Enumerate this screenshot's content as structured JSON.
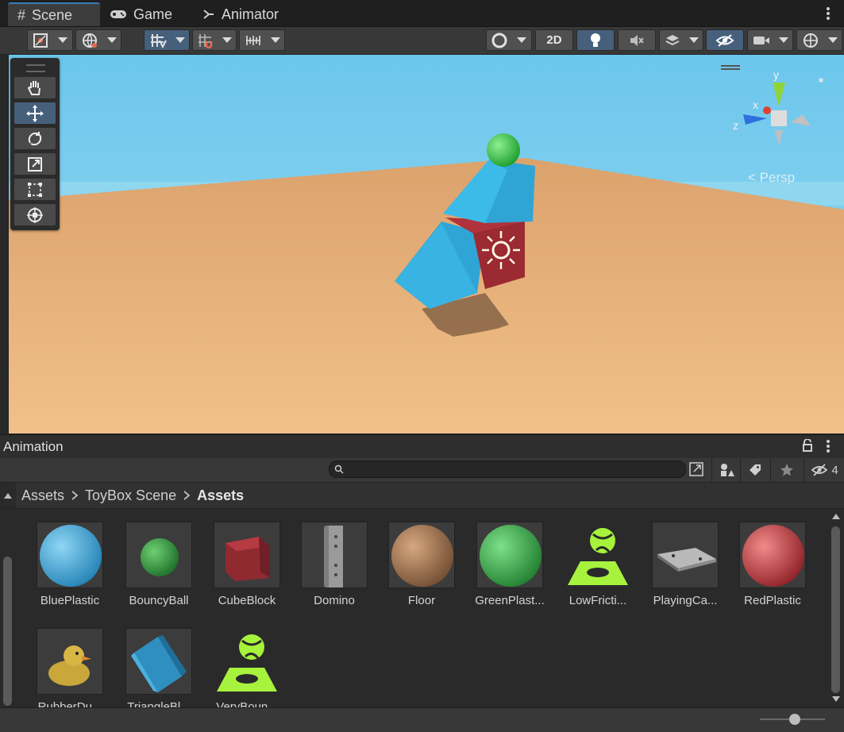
{
  "tabs": [
    {
      "label": "Scene",
      "icon": "grid-icon",
      "active": true
    },
    {
      "label": "Game",
      "icon": "gamepad-icon",
      "active": false
    },
    {
      "label": "Animator",
      "icon": "animator-icon",
      "active": false
    }
  ],
  "toolbar": {
    "mode_2d_label": "2D"
  },
  "scene": {
    "camera_label": "< Persp",
    "gizmo": {
      "x": "x",
      "y": "y",
      "z": "z"
    }
  },
  "animation_panel": {
    "title": "Animation",
    "search_placeholder": "",
    "hidden_count": "4"
  },
  "breadcrumb": [
    "Assets",
    "ToyBox Scene",
    "Assets"
  ],
  "assets": [
    {
      "label": "BluePlastic",
      "kind": "sphere",
      "color": "#3aa6d8"
    },
    {
      "label": "BouncyBall",
      "kind": "small-sphere",
      "color": "#2f8f3a"
    },
    {
      "label": "CubeBlock",
      "kind": "cube",
      "color": "#a8323a"
    },
    {
      "label": "Domino",
      "kind": "domino",
      "color": "#8a8a8a"
    },
    {
      "label": "Floor",
      "kind": "sphere",
      "color": "#a87a55"
    },
    {
      "label": "GreenPlast...",
      "kind": "sphere",
      "color": "#34a845"
    },
    {
      "label": "LowFricti...",
      "kind": "physics-material",
      "color": "#9ef23a"
    },
    {
      "label": "PlayingCa...",
      "kind": "card",
      "color": "#9a9a9a"
    },
    {
      "label": "RedPlastic",
      "kind": "sphere",
      "color": "#c9333a"
    },
    {
      "label": "RubberDu...",
      "kind": "duck",
      "color": "#c9a73a"
    },
    {
      "label": "TriangleBl...",
      "kind": "wedge",
      "color": "#3aa6d8"
    },
    {
      "label": "VeryBoun...",
      "kind": "physics-material",
      "color": "#9ef23a"
    }
  ],
  "colors": {
    "accent": "#3a79bb",
    "selected_tool": "#46607c",
    "sky": "#7fd0ee",
    "sand": "#e9b57e"
  }
}
